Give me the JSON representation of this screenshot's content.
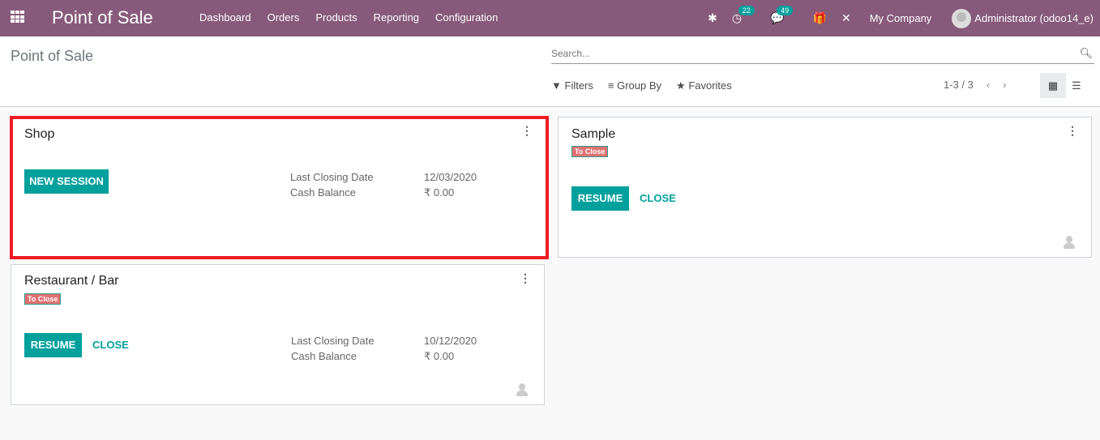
{
  "navbar": {
    "app_title": "Point of Sale",
    "menu": [
      "Dashboard",
      "Orders",
      "Products",
      "Reporting",
      "Configuration"
    ],
    "activity_count": "22",
    "message_count": "49",
    "company": "My Company",
    "user": "Administrator (odoo14_e)"
  },
  "control_panel": {
    "breadcrumb": "Point of Sale",
    "search_placeholder": "Search...",
    "filters_label": "Filters",
    "group_by_label": "Group By",
    "favorites_label": "Favorites",
    "pager": "1-3 / 3"
  },
  "cards": [
    {
      "title": "Shop",
      "primary_button": "NEW SESSION",
      "info_labels": [
        "Last Closing Date",
        "Cash Balance"
      ],
      "info_values": [
        "12/03/2020",
        "₹ 0.00"
      ]
    },
    {
      "title": "Sample",
      "tag": "To Close",
      "primary_button": "RESUME",
      "secondary_button": "CLOSE"
    },
    {
      "title": "Restaurant / Bar",
      "tag": "To Close",
      "primary_button": "RESUME",
      "secondary_button": "CLOSE",
      "info_labels": [
        "Last Closing Date",
        "Cash Balance"
      ],
      "info_values": [
        "10/12/2020",
        "₹ 0.00"
      ]
    }
  ],
  "colors": {
    "navbar": "#875a7b",
    "primary": "#00a09d",
    "highlight": "#ed1c24",
    "tag": "#e07070"
  }
}
